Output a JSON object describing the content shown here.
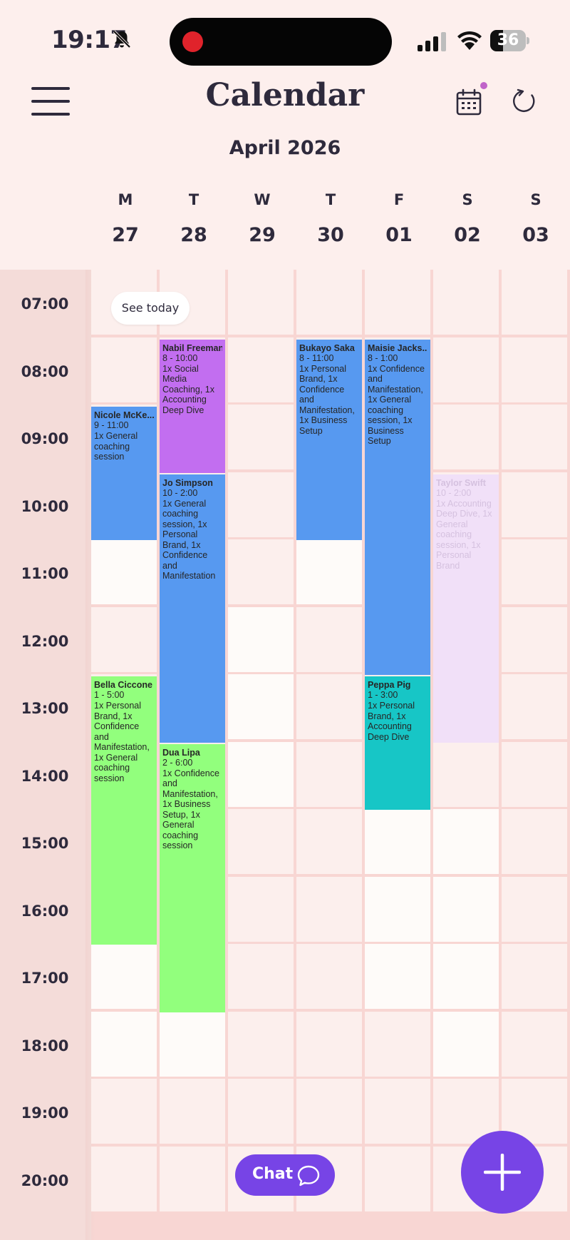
{
  "status_bar": {
    "time": "19:17",
    "battery": "36",
    "battery_level": 0.36
  },
  "header": {
    "title": "Calendar",
    "month": "April 2026"
  },
  "week": {
    "days": [
      {
        "letter": "M",
        "number": "27"
      },
      {
        "letter": "T",
        "number": "28"
      },
      {
        "letter": "W",
        "number": "29"
      },
      {
        "letter": "T",
        "number": "30"
      },
      {
        "letter": "F",
        "number": "01"
      },
      {
        "letter": "S",
        "number": "02"
      },
      {
        "letter": "S",
        "number": "03"
      }
    ]
  },
  "grid": {
    "hours": [
      "07:00",
      "08:00",
      "09:00",
      "10:00",
      "11:00",
      "12:00",
      "13:00",
      "14:00",
      "15:00",
      "16:00",
      "17:00",
      "18:00",
      "19:00",
      "20:00"
    ],
    "available_slots": [
      {
        "day": 0,
        "hours": [
          "11:00",
          "17:00",
          "18:00"
        ]
      },
      {
        "day": 1,
        "hours": [
          "18:00"
        ]
      },
      {
        "day": 2,
        "hours": [
          "12:00",
          "13:00",
          "14:00"
        ]
      },
      {
        "day": 3,
        "hours": [
          "11:00"
        ]
      },
      {
        "day": 4,
        "hours": [
          "15:00",
          "16:00",
          "17:00"
        ]
      },
      {
        "day": 5,
        "hours": [
          "15:00",
          "16:00",
          "17:00",
          "18:00"
        ]
      }
    ]
  },
  "events": [
    {
      "name": "Nicole McKe...",
      "time": "9 - 11:00",
      "services": "1x General coaching session",
      "day": 0,
      "start": 9,
      "end": 11,
      "color": "#5799f0"
    },
    {
      "name": "Bella Ciccone",
      "time": "1 - 5:00",
      "services": "1x Personal Brand, 1x Confidence and Manifestation, 1x General coaching session",
      "day": 0,
      "start": 13,
      "end": 17,
      "color": "#92ff7d"
    },
    {
      "name": "Nabil Freeman",
      "time": "8 - 10:00",
      "services": "1x Social Media Coaching, 1x Accounting Deep Dive",
      "day": 1,
      "start": 8,
      "end": 10,
      "color": "#c26ef0"
    },
    {
      "name": "Jo Simpson",
      "time": "10 - 2:00",
      "services": "1x General coaching session, 1x Personal Brand, 1x Confidence and Manifestation",
      "day": 1,
      "start": 10,
      "end": 14,
      "color": "#5799f0"
    },
    {
      "name": "Dua Lipa",
      "time": "2 - 6:00",
      "services": "1x Confidence and Manifestation, 1x Business Setup, 1x General coaching session",
      "day": 1,
      "start": 14,
      "end": 18,
      "color": "#92ff7d"
    },
    {
      "name": "Bukayo Saka",
      "time": "8 - 11:00",
      "services": "1x Personal Brand, 1x Confidence and Manifestation, 1x Business Setup",
      "day": 3,
      "start": 8,
      "end": 11,
      "color": "#5799f0"
    },
    {
      "name": "Maisie Jacks...",
      "time": "8 - 1:00",
      "services": "1x Confidence and Manifestation, 1x General coaching session, 1x Business Setup",
      "day": 4,
      "start": 8,
      "end": 13,
      "color": "#5799f0"
    },
    {
      "name": "Peppa Pig",
      "time": "1 - 3:00",
      "services": "1x Personal Brand, 1x Accounting Deep Dive",
      "day": 4,
      "start": 13,
      "end": 15,
      "color": "#17c6c6"
    },
    {
      "name": "Taylor Swift",
      "time": "10 - 2:00",
      "services": "1x Accounting Deep Dive, 1x General coaching session, 1x Personal Brand",
      "day": 5,
      "start": 10,
      "end": 14,
      "color": "#f1e0f8",
      "faded": true
    }
  ],
  "buttons": {
    "see_today": "See today",
    "chat": "Chat"
  },
  "icons": {
    "menu": "hamburger-menu-icon",
    "calendar": "calendar-icon",
    "refresh": "refresh-icon",
    "chat": "chat-bubble-icon",
    "add": "plus-icon",
    "bell_muted": "bell-slash-icon"
  }
}
